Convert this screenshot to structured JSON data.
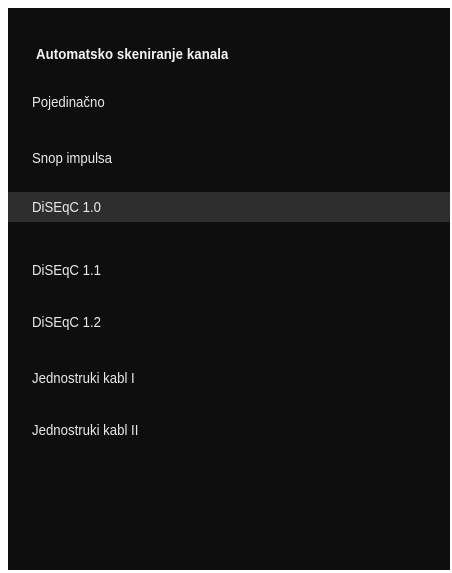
{
  "panel": {
    "title": "Automatsko skeniranje kanala",
    "background": "#0e0e0e",
    "highlight": "#2e2e2e"
  },
  "menu": {
    "focused_index": 2,
    "items": [
      {
        "label": "Pojedinačno"
      },
      {
        "label": "Snop impulsa"
      },
      {
        "label": "DiSEqC 1.0"
      },
      {
        "label": "DiSEqC 1.1"
      },
      {
        "label": "DiSEqC 1.2"
      },
      {
        "label": "Jednostruki kabl I"
      },
      {
        "label": "Jednostruki kabl II"
      }
    ]
  }
}
